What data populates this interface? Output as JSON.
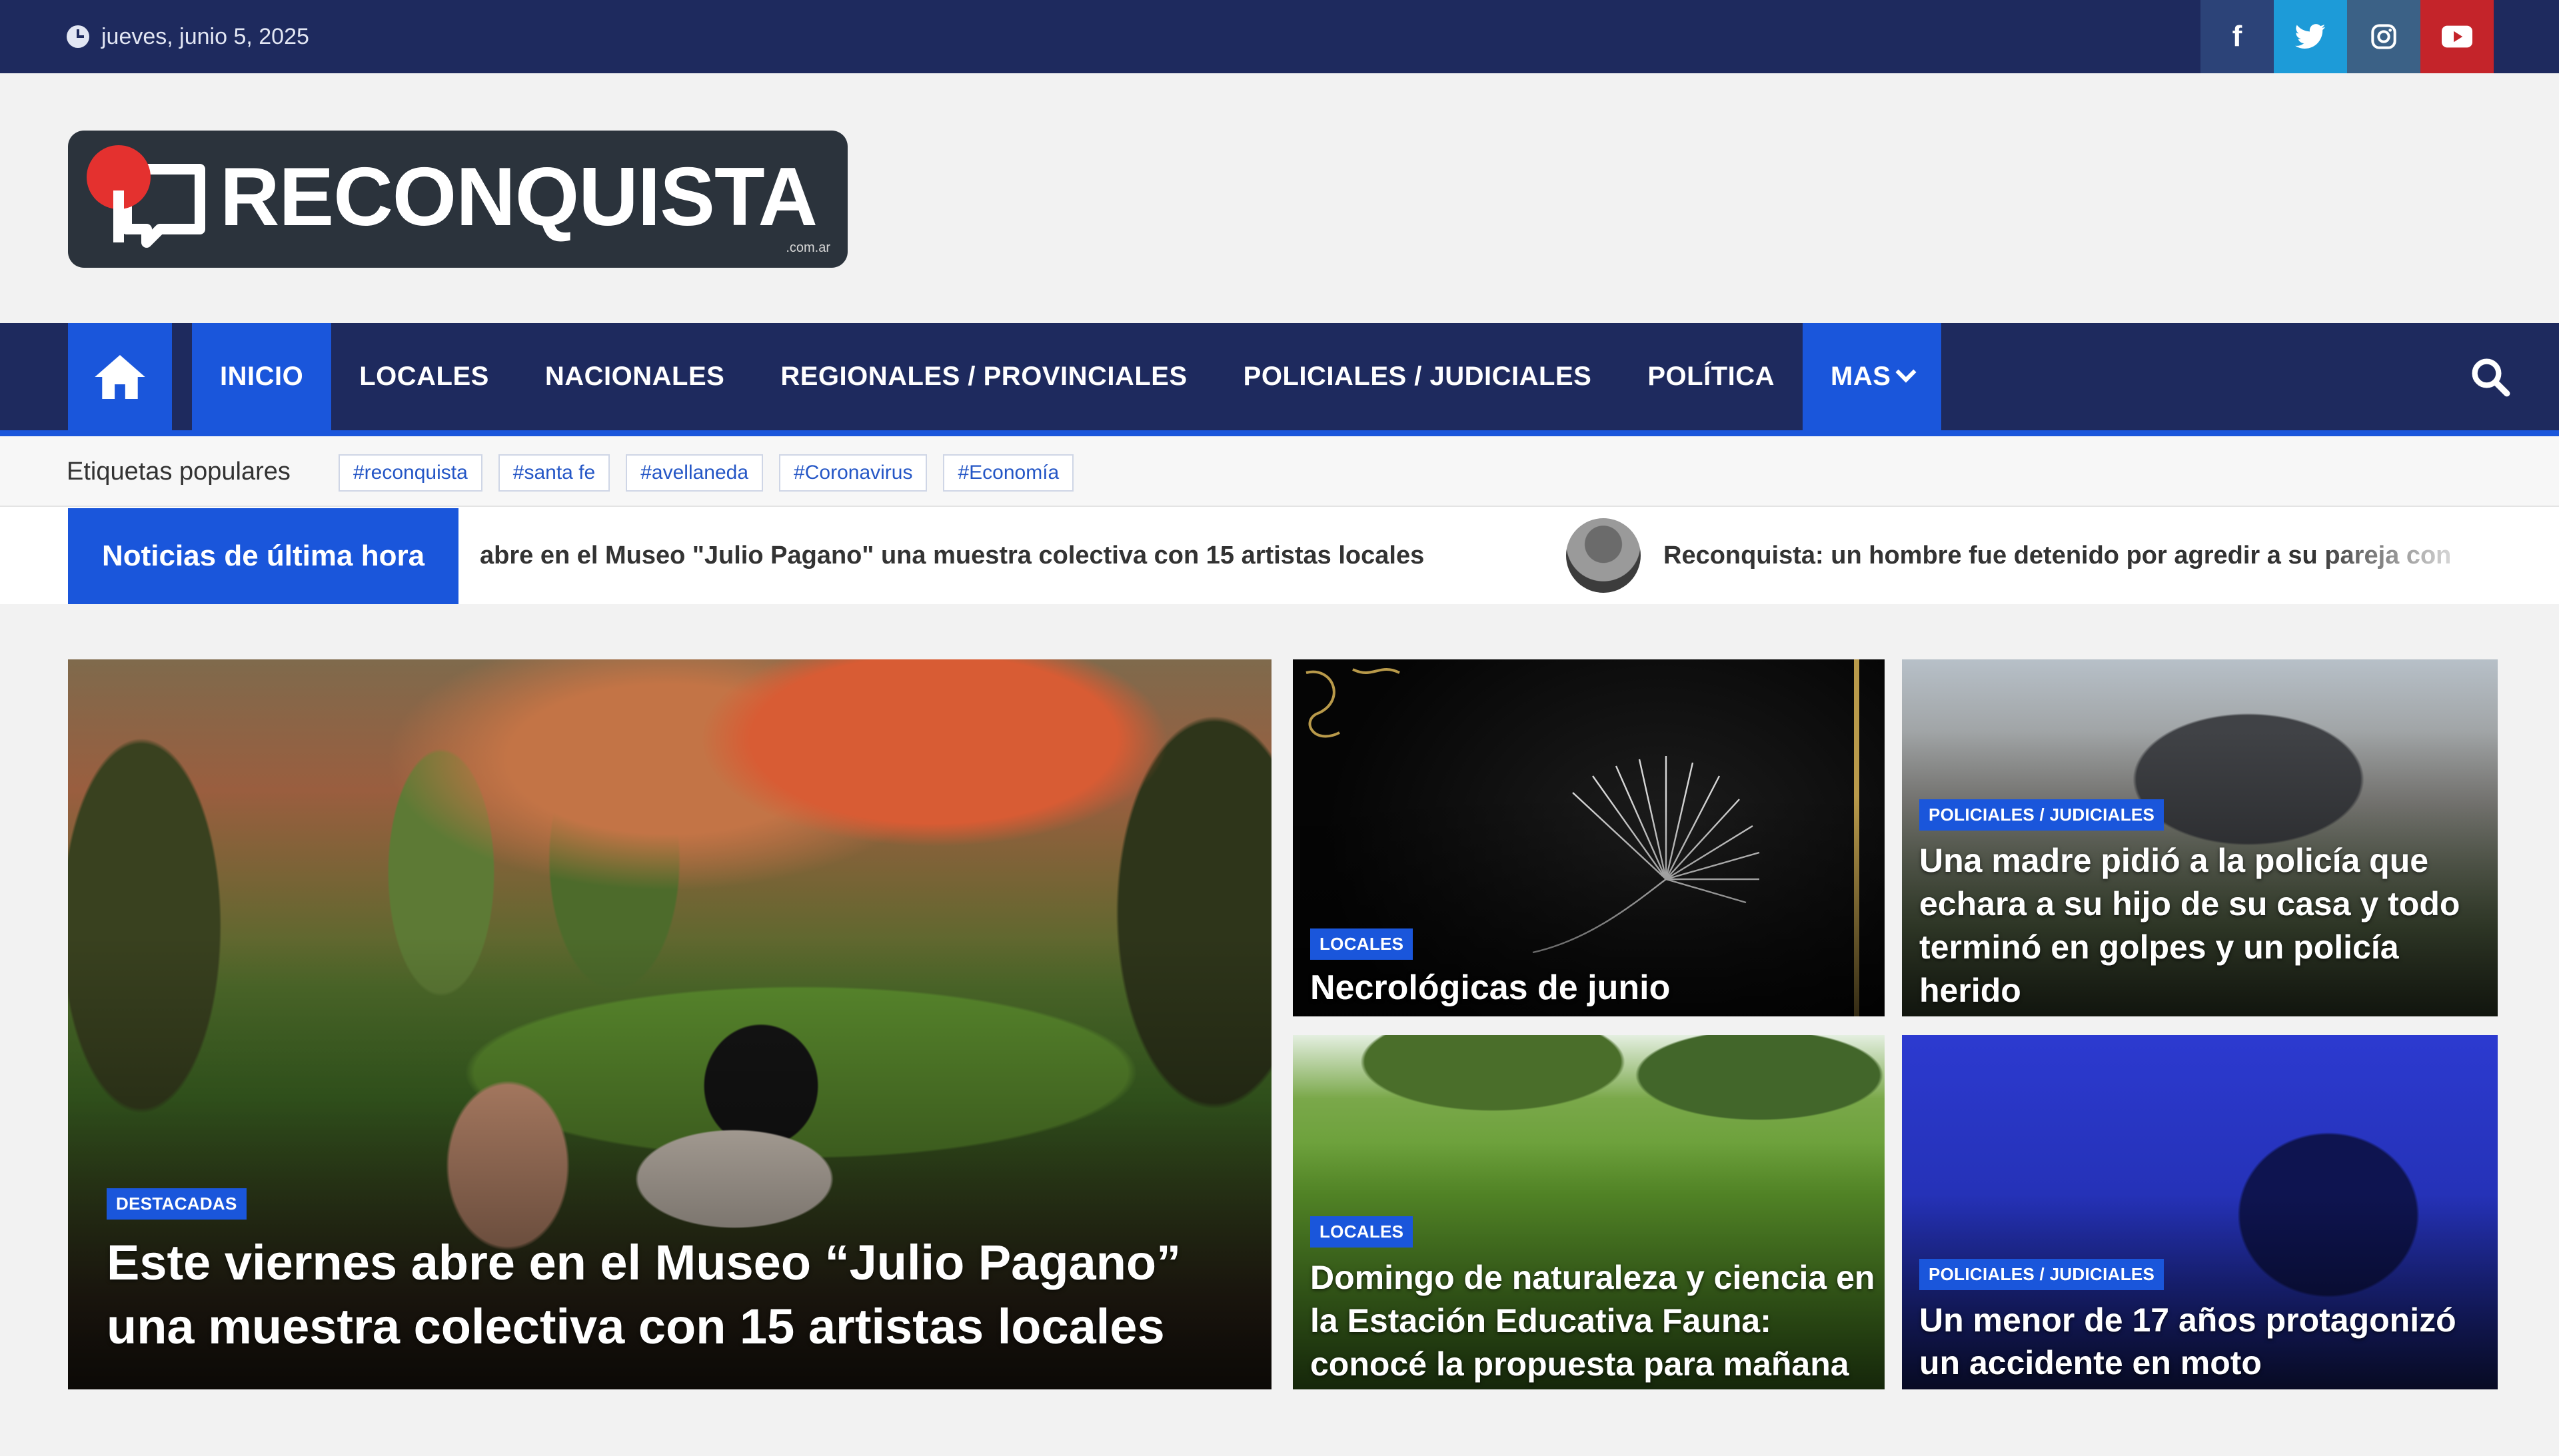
{
  "topbar": {
    "date": "jueves, junio 5, 2025",
    "socials": [
      {
        "icon": "facebook-icon",
        "glyph": "f",
        "color": "#2c4378"
      },
      {
        "icon": "twitter-icon",
        "glyph": "t",
        "color": "#1d9bd8"
      },
      {
        "icon": "instagram-icon",
        "glyph": "◎",
        "color": "#3b6186"
      },
      {
        "icon": "youtube-icon",
        "glyph": "▶",
        "color": "#c4242a"
      }
    ]
  },
  "logo": {
    "text": "RECONQUISTA",
    "sub": ".com.ar"
  },
  "nav": {
    "items": [
      "INICIO",
      "LOCALES",
      "NACIONALES",
      "REGIONALES / PROVINCIALES",
      "POLICIALES / JUDICIALES",
      "POLÍTICA",
      "MAS"
    ]
  },
  "tags": {
    "label": "Etiquetas populares",
    "items": [
      "#reconquista",
      "#santa fe",
      "#avellaneda",
      "#Coronavirus",
      "#Economía"
    ]
  },
  "ticker": {
    "label": "Noticias de última hora",
    "items": [
      "abre en el Museo \"Julio Pagano\" una muestra colectiva con 15 artistas locales",
      "Reconquista: un hombre fue detenido por agredir a su pareja con"
    ]
  },
  "cards": {
    "main": {
      "badge": "DESTACADAS",
      "headline": "Este viernes abre en el Museo “Julio Pagano” una muestra colectiva con 15 artistas locales"
    },
    "necro": {
      "badge": "LOCALES",
      "headline": "Necrológicas de junio"
    },
    "madre": {
      "badge": "POLICIALES / JUDICIALES",
      "headline": "Una madre pidió a la policía que echara a su hijo de su casa y todo terminó en golpes y un policía herido"
    },
    "domingo": {
      "badge": "LOCALES",
      "headline": "Domingo de naturaleza y ciencia en la Estación Educativa Fauna: conocé la propuesta para mañana"
    },
    "menor": {
      "badge": "POLICIALES / JUDICIALES",
      "headline": "Un menor de 17 años protagonizó un accidente en moto"
    }
  },
  "colors": {
    "navy": "#1e2a5e",
    "accent_blue": "#1a56db",
    "logo_bg": "#2b333c",
    "logo_dot": "#e4312f"
  }
}
